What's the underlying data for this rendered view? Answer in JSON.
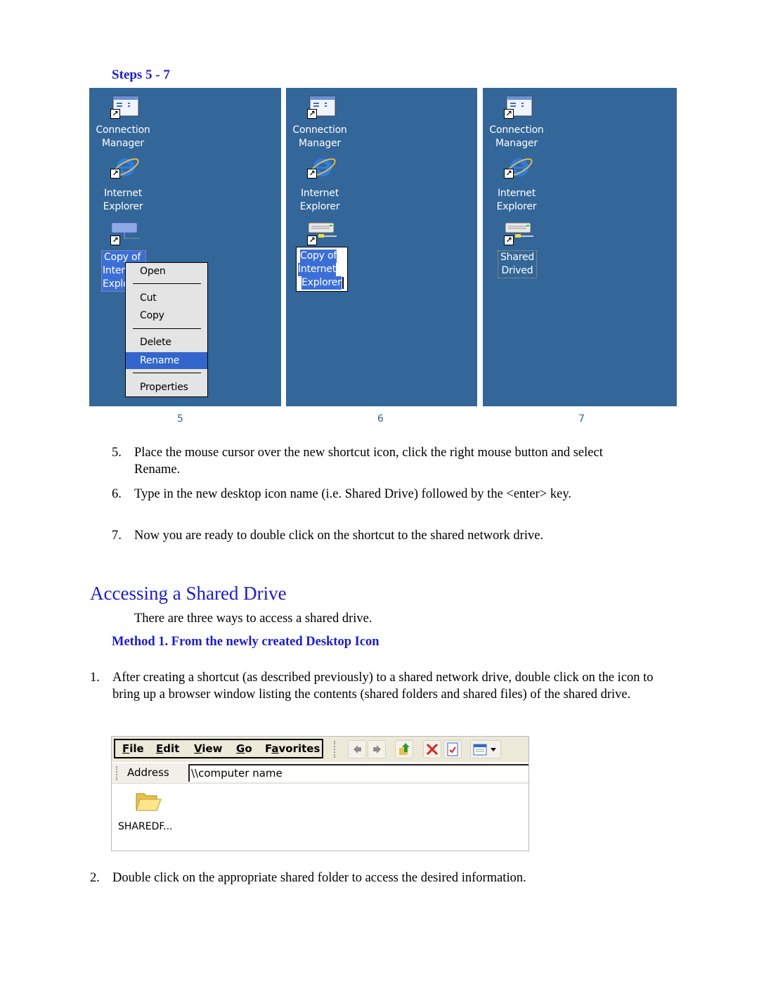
{
  "steps_title": "Steps 5 - 7",
  "panels": [
    {
      "number": "5",
      "icons": [
        {
          "name": "connection-manager",
          "line1": "Connection",
          "line2": "Manager"
        },
        {
          "name": "internet-explorer",
          "line1": "Internet",
          "line2": "Explorer"
        },
        {
          "name": "network-drive",
          "line1": "Copy of",
          "line2": "Inter",
          "line3": "Explo"
        }
      ],
      "context_menu": {
        "items": [
          "Open",
          "Cut",
          "Copy",
          "Delete",
          "Rename",
          "Properties"
        ],
        "selected": "Rename"
      }
    },
    {
      "number": "6",
      "icons": [
        {
          "name": "connection-manager",
          "line1": "Connection",
          "line2": "Manager"
        },
        {
          "name": "internet-explorer",
          "line1": "Internet",
          "line2": "Explorer"
        },
        {
          "name": "network-drive",
          "line1": "Copy of",
          "line2": "Internet",
          "line3": "Explorer"
        }
      ]
    },
    {
      "number": "7",
      "icons": [
        {
          "name": "connection-manager",
          "line1": "Connection",
          "line2": "Manager"
        },
        {
          "name": "internet-explorer",
          "line1": "Internet",
          "line2": "Explorer"
        },
        {
          "name": "network-drive",
          "line1": "Shared",
          "line2": "Drived"
        }
      ]
    }
  ],
  "steps": [
    {
      "num": "5.",
      "text": "Place the mouse cursor over the new shortcut icon, click the right mouse button and select Rename."
    },
    {
      "num": "6.",
      "text": "Type in the new desktop icon name (i.e. Shared Drive) followed by the <enter> key."
    },
    {
      "num": "7.",
      "text": "Now you are ready to double click on the shortcut to the shared network drive."
    }
  ],
  "section_heading": "Accessing a Shared Drive",
  "intro": "There are three ways to access a shared drive.",
  "method_heading": "Method 1.  From the newly created Desktop Icon",
  "method_steps": [
    {
      "num": "1.",
      "text": "After creating a shortcut (as described previously) to a shared network drive, double click on the icon to bring up a browser window listing the contents (shared folders and shared files) of the shared drive."
    },
    {
      "num": "2.",
      "text": "Double click on the appropriate shared folder to access the desired information."
    }
  ],
  "explorer": {
    "menu": [
      "File",
      "Edit",
      "View",
      "Go",
      "Favorites"
    ],
    "menu_accel": [
      "F",
      "E",
      "V",
      "G",
      "a"
    ],
    "toolbar_icons": [
      "back-icon",
      "forward-icon",
      "up-folder-icon",
      "delete-icon",
      "properties-icon",
      "view-menu-icon"
    ],
    "address_label": "Address",
    "address_value": "\\\\computer name",
    "folder_label": "SHAREDF..."
  },
  "colors": {
    "desktop_bg": "#336699",
    "heading_blue": "#1a1adc",
    "menu_highlight": "#3366cc"
  }
}
